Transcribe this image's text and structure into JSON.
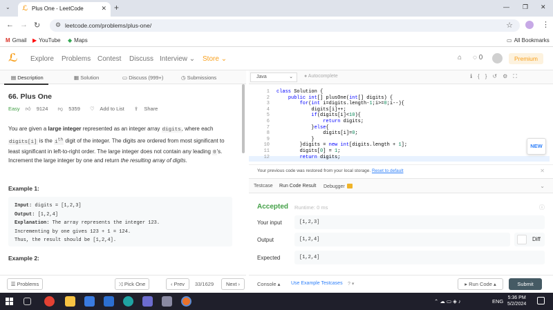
{
  "browser": {
    "tab_title": "Plus One - LeetCode",
    "url": "leetcode.com/problems/plus-one/",
    "bookmarks": [
      "Gmail",
      "YouTube",
      "Maps"
    ],
    "all_bookmarks": "All Bookmarks"
  },
  "nav": {
    "links": [
      "Explore",
      "Problems",
      "Contest",
      "Discuss",
      "Interview",
      "Store"
    ],
    "notif_count": "0",
    "premium": "Premium"
  },
  "left_tabs": [
    "Description",
    "Solution",
    "Discuss (999+)",
    "Submissions"
  ],
  "problem": {
    "title": "66. Plus One",
    "difficulty": "Easy",
    "likes": "9124",
    "dislikes": "5359",
    "add_to_list": "Add to List",
    "share": "Share",
    "p1_a": "You are given a ",
    "p1_b": "large integer",
    "p1_c": " represented as an integer array ",
    "p1_d": "digits",
    "p1_e": ", where each",
    "p1_f": "digits[i]",
    "p1_g": " is the ",
    "p1_h": "i",
    "p1_sup": "th",
    "p1_i": " digit of the integer. The digits are ordered from most significant to least significant in left-to-right order. The large integer does not contain any leading ",
    "p1_j": "0",
    "p1_k": "'s.",
    "p2_a": "Increment the large integer by one and return ",
    "p2_b": "the resulting array of digits",
    "p2_c": ".",
    "example1_title": "Example 1:",
    "example1": {
      "input_label": "Input:",
      "input": " digits = [1,2,3]",
      "output_label": "Output:",
      "output": " [1,2,4]",
      "expl_label": "Explanation:",
      "expl1": " The array represents the integer 123.",
      "expl2": "Incrementing by one gives 123 + 1 = 124.",
      "expl3": "Thus, the result should be [1,2,4]."
    },
    "example2_title": "Example 2:"
  },
  "left_footer": {
    "problems": "Problems",
    "pick_one": "Pick One",
    "prev": "Prev",
    "pager": "33/1629",
    "next": "Next"
  },
  "editor": {
    "language": "Java",
    "autocomplete": "Autocomplete",
    "line_numbers": [
      "1",
      "2",
      "3",
      "4",
      "5",
      "6",
      "7",
      "8",
      "9",
      "10",
      "11",
      "12"
    ],
    "new_badge": "NEW"
  },
  "restore": {
    "message": "Your previous code was restored from your local storage.",
    "reset": "Reset to default"
  },
  "result_tabs": [
    "Testcase",
    "Run Code Result",
    "Debugger"
  ],
  "result": {
    "status": "Accepted",
    "runtime": "Runtime: 0 ms",
    "your_input_label": "Your input",
    "your_input": "[1,2,3]",
    "output_label": "Output",
    "output": "[1,2,4]",
    "diff": "Diff",
    "expected_label": "Expected",
    "expected": "[1,2,4]"
  },
  "right_footer": {
    "console": "Console",
    "use_example": "Use Example Testcases",
    "run_code": "Run Code",
    "submit": "Submit"
  },
  "taskbar": {
    "lang": "ENG",
    "time": "5:36 PM",
    "date": "5/2/2024"
  }
}
